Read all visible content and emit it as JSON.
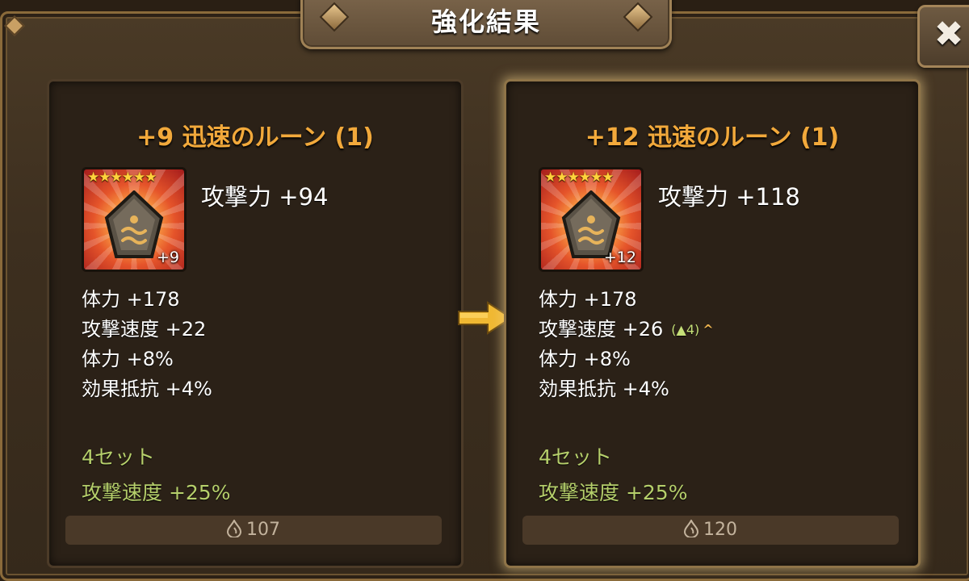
{
  "header": {
    "title": "強化結果"
  },
  "close": {
    "label": "✖",
    "icon": "close-icon"
  },
  "before": {
    "title": "+9 迅速のルーン (1)",
    "stars": "★★★★★★",
    "level_badge": "+9",
    "main_stat": "攻撃力 +94",
    "sub_stats": [
      "体力 +178",
      "攻撃速度 +22",
      "体力 +8%",
      "効果抵抗 +4%"
    ],
    "set_count": "4セット",
    "set_effect": "攻撃速度 +25%",
    "value": "107"
  },
  "after": {
    "title": "+12 迅速のルーン (1)",
    "stars": "★★★★★★",
    "level_badge": "+12",
    "main_stat": "攻撃力 +118",
    "sub_stats": [
      "体力 +178",
      "攻撃速度 +26",
      "体力 +8%",
      "効果抵抗 +4%"
    ],
    "upgrade_bonus": "(▲4)",
    "upgrade_caret": "^",
    "set_count": "4セット",
    "set_effect": "攻撃速度 +25%",
    "value": "120"
  },
  "colors": {
    "title_orange": "#f2a93b",
    "set_green": "#b6cf6b",
    "bonus_green": "#c6e078",
    "arrow_gold": "#f0b832"
  }
}
